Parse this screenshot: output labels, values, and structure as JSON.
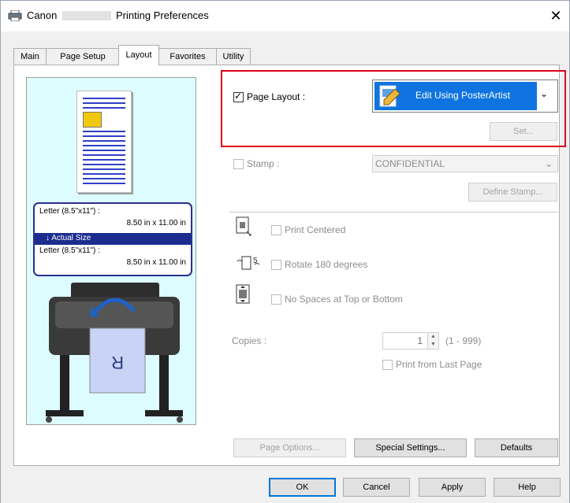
{
  "window": {
    "title_brand": "Canon",
    "title_suffix": "Printing Preferences",
    "close_glyph": "✕"
  },
  "tabs": [
    {
      "label": "Main",
      "active": false
    },
    {
      "label": "Page Setup",
      "active": false
    },
    {
      "label": "Layout",
      "active": true
    },
    {
      "label": "Favorites",
      "active": false
    },
    {
      "label": "Utility",
      "active": false
    }
  ],
  "preview": {
    "paper_size_line1": "Letter (8.5\"x11\") :",
    "paper_size_dims1": "8.50 in x 11.00 in",
    "output_label": "↓  Actual Size",
    "paper_size_line2": "Letter (8.5\"x11\") :",
    "paper_size_dims2": "8.50 in x 11.00 in"
  },
  "layout": {
    "page_layout_label": "Page Layout :",
    "page_layout_checked": true,
    "page_layout_value": "Edit Using PosterArtist",
    "set_button": "Set..."
  },
  "stamp": {
    "label": "Stamp :",
    "checked": false,
    "value": "CONFIDENTIAL",
    "define_button": "Define Stamp..."
  },
  "options": {
    "print_centered": "Print Centered",
    "rotate_180": "Rotate 180 degrees",
    "no_spaces": "No Spaces at Top or Bottom"
  },
  "copies": {
    "label": "Copies :",
    "value": "1",
    "range": "(1 - 999)",
    "print_from_last": "Print from Last Page"
  },
  "panel_buttons": {
    "page_options": "Page Options...",
    "special_settings": "Special Settings...",
    "defaults": "Defaults"
  },
  "dialog_buttons": {
    "ok": "OK",
    "cancel": "Cancel",
    "apply": "Apply",
    "help": "Help"
  },
  "colors": {
    "accent": "#0f74df",
    "highlight_frame": "#e0001b",
    "preview_bg": "#ddfcff",
    "info_bar": "#1c2d8f"
  }
}
